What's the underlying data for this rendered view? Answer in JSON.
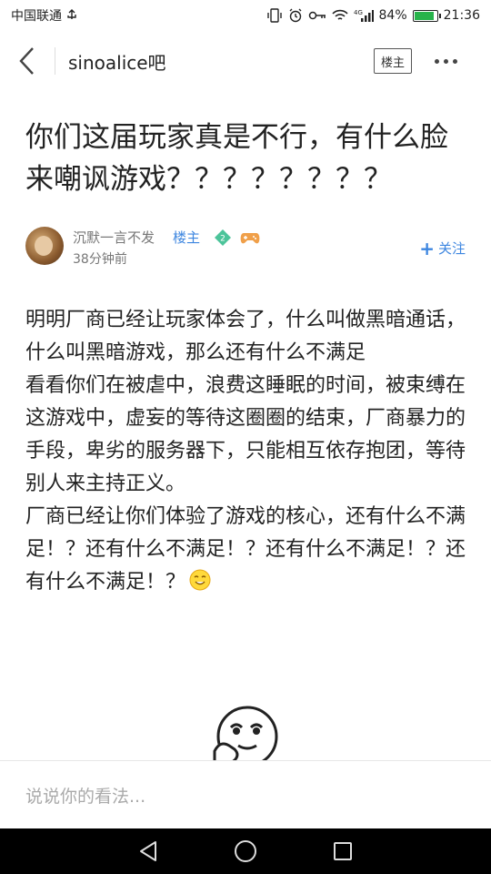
{
  "status_bar": {
    "carrier": "中国联通",
    "battery_percent": "84%",
    "battery_level": 0.84,
    "time": "21:36",
    "icons": [
      "usb-icon",
      "vibrate-icon",
      "alarm-icon",
      "key-icon",
      "wifi-icon",
      "4g-signal-icon",
      "battery-icon"
    ]
  },
  "header": {
    "title": "sinoalice吧",
    "owner_button": "楼主"
  },
  "post": {
    "title": "你们这届玩家真是不行，有什么脸来嘲讽游戏？？？？？？？？",
    "author": {
      "name": "沉默一言不发",
      "tag": "楼主",
      "level": "2",
      "time": "38分钟前",
      "follow_label": "关注"
    },
    "paragraphs": [
      "明明厂商已经让玩家体会了，什么叫做黑暗通话，什么叫黑暗游戏，那么还有什么不满足",
      "看看你们在被虐中，浪费这睡眠的时间，被束缚在这游戏中，虚妄的等待这圈圈的结束，厂商暴力的手段，卑劣的服务器下，只能相互依存抱团，等待别人来主持正义。",
      "厂商已经让你们体验了游戏的核心，还有什么不满足！？还有什么不满足！？还有什么不满足！？还有什么不满足！？"
    ]
  },
  "comment": {
    "placeholder": "说说你的看法..."
  },
  "colors": {
    "accent": "#3d86e0",
    "battery": "#27b34a",
    "level_badge": "#4cc49a"
  }
}
